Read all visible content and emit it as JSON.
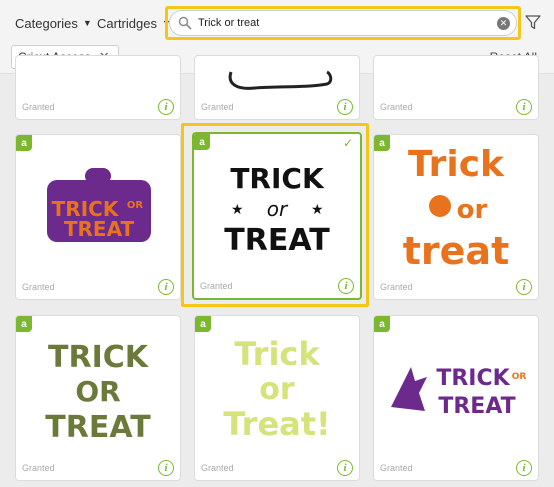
{
  "toolbar": {
    "categories_label": "Categories",
    "cartridges_label": "Cartridges",
    "search_value": "Trick or treat"
  },
  "filters": {
    "chip_label": "Cricut Access",
    "reset_label": "Reset All"
  },
  "cards": [
    {
      "status": "Granted"
    },
    {
      "status": "Granted"
    },
    {
      "status": "Granted"
    },
    {
      "status": "Granted",
      "art": [
        "TRICK",
        "OR",
        "TREAT"
      ]
    },
    {
      "status": "Granted",
      "art": [
        "TRICK",
        "or",
        "TREAT"
      ]
    },
    {
      "status": "Granted",
      "art": [
        "Trick",
        "or",
        "treat"
      ]
    },
    {
      "status": "Granted",
      "art": [
        "TRICK",
        "OR",
        "TREAT"
      ]
    },
    {
      "status": "Granted",
      "art": [
        "Trick",
        "or",
        "Treat!"
      ]
    },
    {
      "status": "Granted",
      "art": [
        "TRICK",
        "OR",
        "TREAT"
      ]
    }
  ],
  "badge_letter": "a",
  "colors": {
    "accent_green": "#7cb82f",
    "highlight_yellow": "#f5c518",
    "orange": "#e8731c",
    "purple": "#6b2a8c",
    "olive": "#6b7a3a",
    "lime": "#d6e27a"
  }
}
